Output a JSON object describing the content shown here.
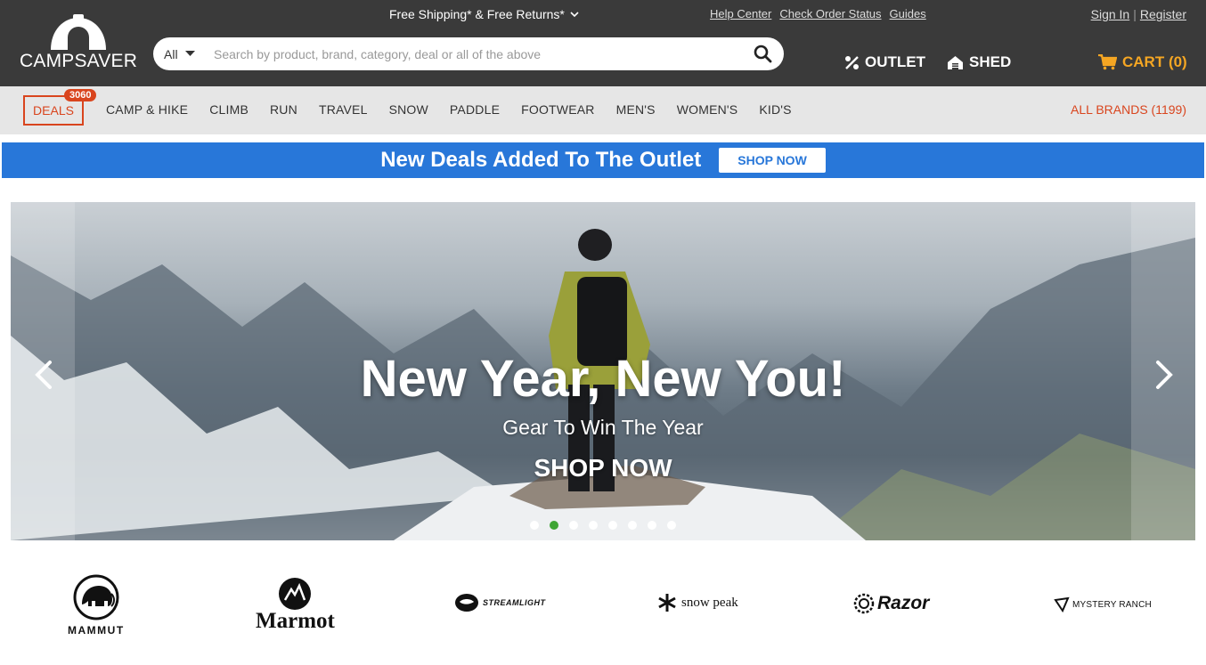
{
  "header": {
    "logo_text": "CAMPSAVER",
    "shipping": "Free Shipping* & Free Returns*",
    "top_links": [
      "Help Center",
      "Check Order Status",
      "Guides"
    ],
    "sign_in": "Sign In",
    "separator": "|",
    "register": "Register",
    "search": {
      "category": "All",
      "placeholder": "Search by product, brand, category, deal or all of the above"
    },
    "outlet": "OUTLET",
    "shed": "SHED",
    "cart": "CART (0)"
  },
  "nav": {
    "deals": "DEALS",
    "deals_count": "3060",
    "categories": [
      "CAMP & HIKE",
      "CLIMB",
      "RUN",
      "TRAVEL",
      "SNOW",
      "PADDLE",
      "FOOTWEAR",
      "MEN'S",
      "WOMEN'S",
      "KID'S"
    ],
    "all_brands": "ALL BRANDS (1199)"
  },
  "promo": {
    "text": "New Deals Added To The Outlet",
    "button": "SHOP NOW"
  },
  "hero": {
    "headline": "New Year, New You!",
    "subtitle": "Gear To Win The Year",
    "cta": "SHOP NOW",
    "slide_count": 8,
    "active_slide": 2
  },
  "brands": {
    "mammut": "MAMMUT",
    "marmot": "Marmot",
    "streamlight": "STREAMLIGHT",
    "snowpeak": "snow peak",
    "razor": "Razor",
    "mysteryranch": "MYSTERY RANCH"
  },
  "colors": {
    "header_bg": "#3a3a3a",
    "accent_orange": "#d9451e",
    "cart_yellow": "#f5a623",
    "promo_blue": "#2877d9",
    "dot_active": "#3fa535"
  }
}
